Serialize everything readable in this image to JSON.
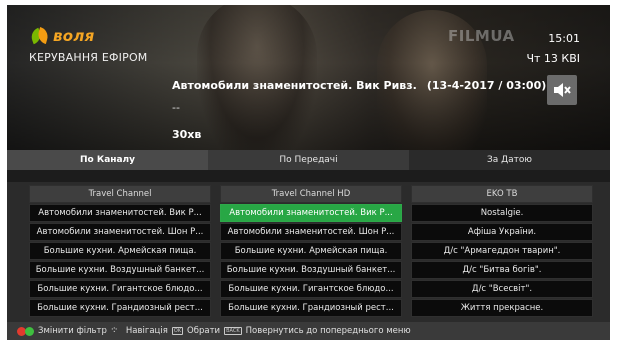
{
  "brand": {
    "name": "воля",
    "colors": {
      "leaf_green": "#7ab800",
      "leaf_orange": "#f39c12",
      "text": "#f5a623"
    }
  },
  "header": {
    "control_title": "КЕРУВАННЯ ЕФІРОМ",
    "watermark": "FILMUA",
    "time": "15:01",
    "date": "Чт 13 КВІ",
    "mute_icon": "mute-speaker-icon"
  },
  "program": {
    "title": "Автомобили знаменитостей. Вик Ривз.",
    "airdate": "(13-4-2017 / 03:00)",
    "subtitle": "--",
    "duration": "30хв"
  },
  "tabs": [
    {
      "label": "По Каналу",
      "active": true
    },
    {
      "label": "По Передачі",
      "active": false
    },
    {
      "label": "За Датою",
      "active": false
    }
  ],
  "columns": [
    {
      "header": "Travel Channel",
      "items": [
        "Автомобили знаменитостей. Вик Р...",
        "Автомобили знаменитостей. Шон Р...",
        "Большие кухни. Армейская пища.",
        "Большие кухни. Воздушный банкет...",
        "Большие кухни. Гигантское блюдо...",
        "Большие кухни. Грандиозный рест..."
      ]
    },
    {
      "header": "Travel Channel HD",
      "items": [
        "Автомобили знаменитостей. Вик Р...",
        "Автомобили знаменитостей. Шон Р...",
        "Большие кухни. Армейская пища.",
        "Большие кухни. Воздушный банкет...",
        "Большие кухни. Гигантское блюдо...",
        "Большие кухни. Грандиозный рест..."
      ],
      "selected_index": 0
    },
    {
      "header": "EKO ТВ",
      "items": [
        "Nostalgie.",
        "Афіша України.",
        "Д/с \"Армагеддон тварин\".",
        "Д/с \"Битва богів\".",
        "Д/с \"Всесвіт\".",
        "Життя прекрасне."
      ]
    }
  ],
  "footer": {
    "change_filter": "Змінити фільтр",
    "navigation": "Навігація",
    "select": "Обрати",
    "back": "Повернутись до попереднього меню",
    "ok_key": "OK",
    "back_key": "BACK",
    "colors": {
      "red": "#e23b2e",
      "green": "#3fbf3f"
    }
  },
  "colors": {
    "selected_row": "#28a745"
  }
}
